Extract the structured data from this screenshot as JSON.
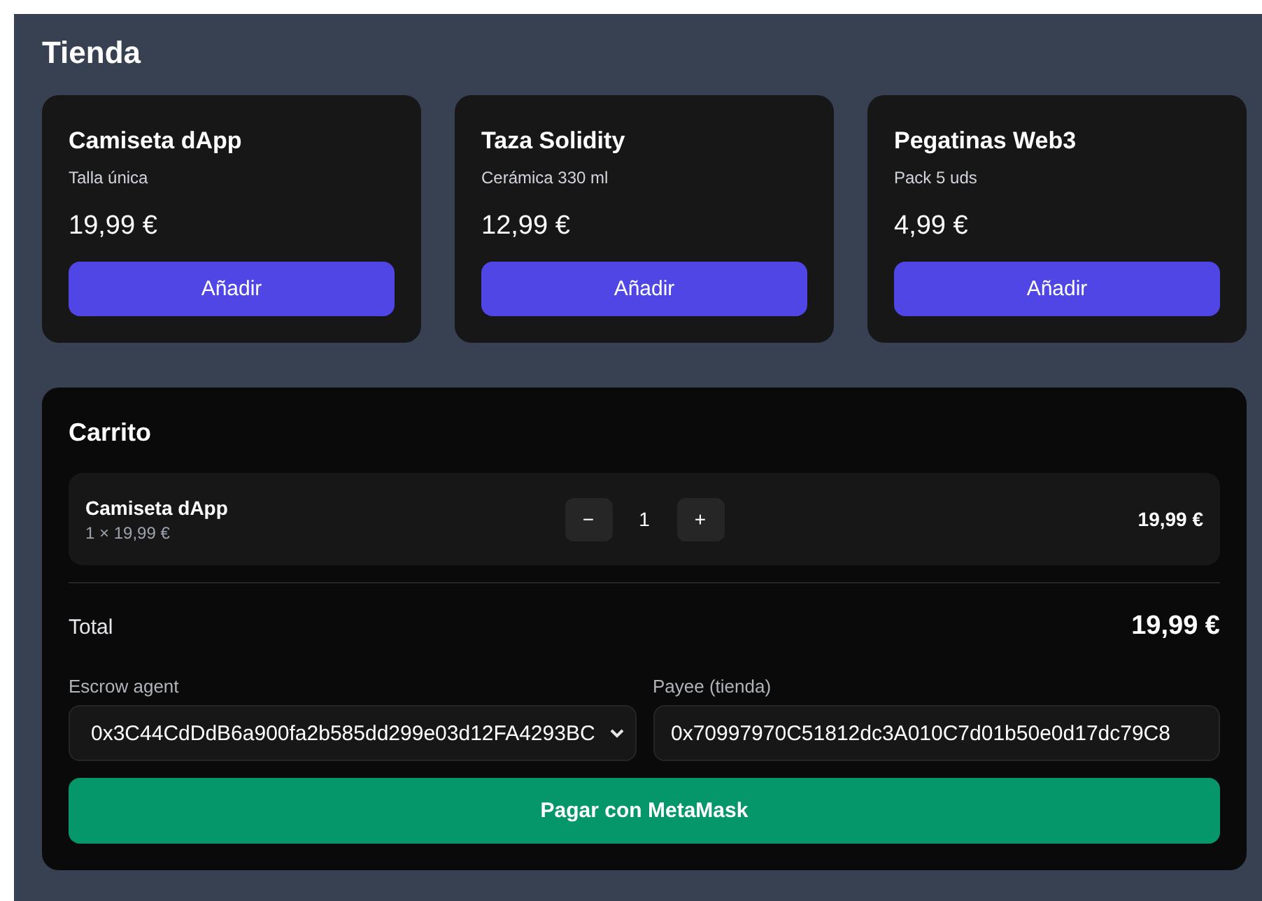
{
  "title": "Tienda",
  "products": [
    {
      "name": "Camiseta dApp",
      "description": "Talla única",
      "price": "19,99 €",
      "button": "Añadir"
    },
    {
      "name": "Taza Solidity",
      "description": "Cerámica 330 ml",
      "price": "12,99 €",
      "button": "Añadir"
    },
    {
      "name": "Pegatinas Web3",
      "description": "Pack 5 uds",
      "price": "4,99 €",
      "button": "Añadir"
    }
  ],
  "cart": {
    "title": "Carrito",
    "items": [
      {
        "name": "Camiseta dApp",
        "unit": "1 × 19,99 €",
        "decrease": "−",
        "quantity": "1",
        "increase": "+",
        "subtotal": "19,99 €"
      }
    ],
    "total_label": "Total",
    "total": "19,99 €",
    "escrow": {
      "label": "Escrow agent",
      "value": "0x3C44CdDdB6a900fa2b585dd299e03d12FA4293BC"
    },
    "payee": {
      "label": "Payee (tienda)",
      "value": "0x70997970C51812dc3A010C7d01b50e0d17dc79C8"
    },
    "pay_button": "Pagar con MetaMask"
  }
}
